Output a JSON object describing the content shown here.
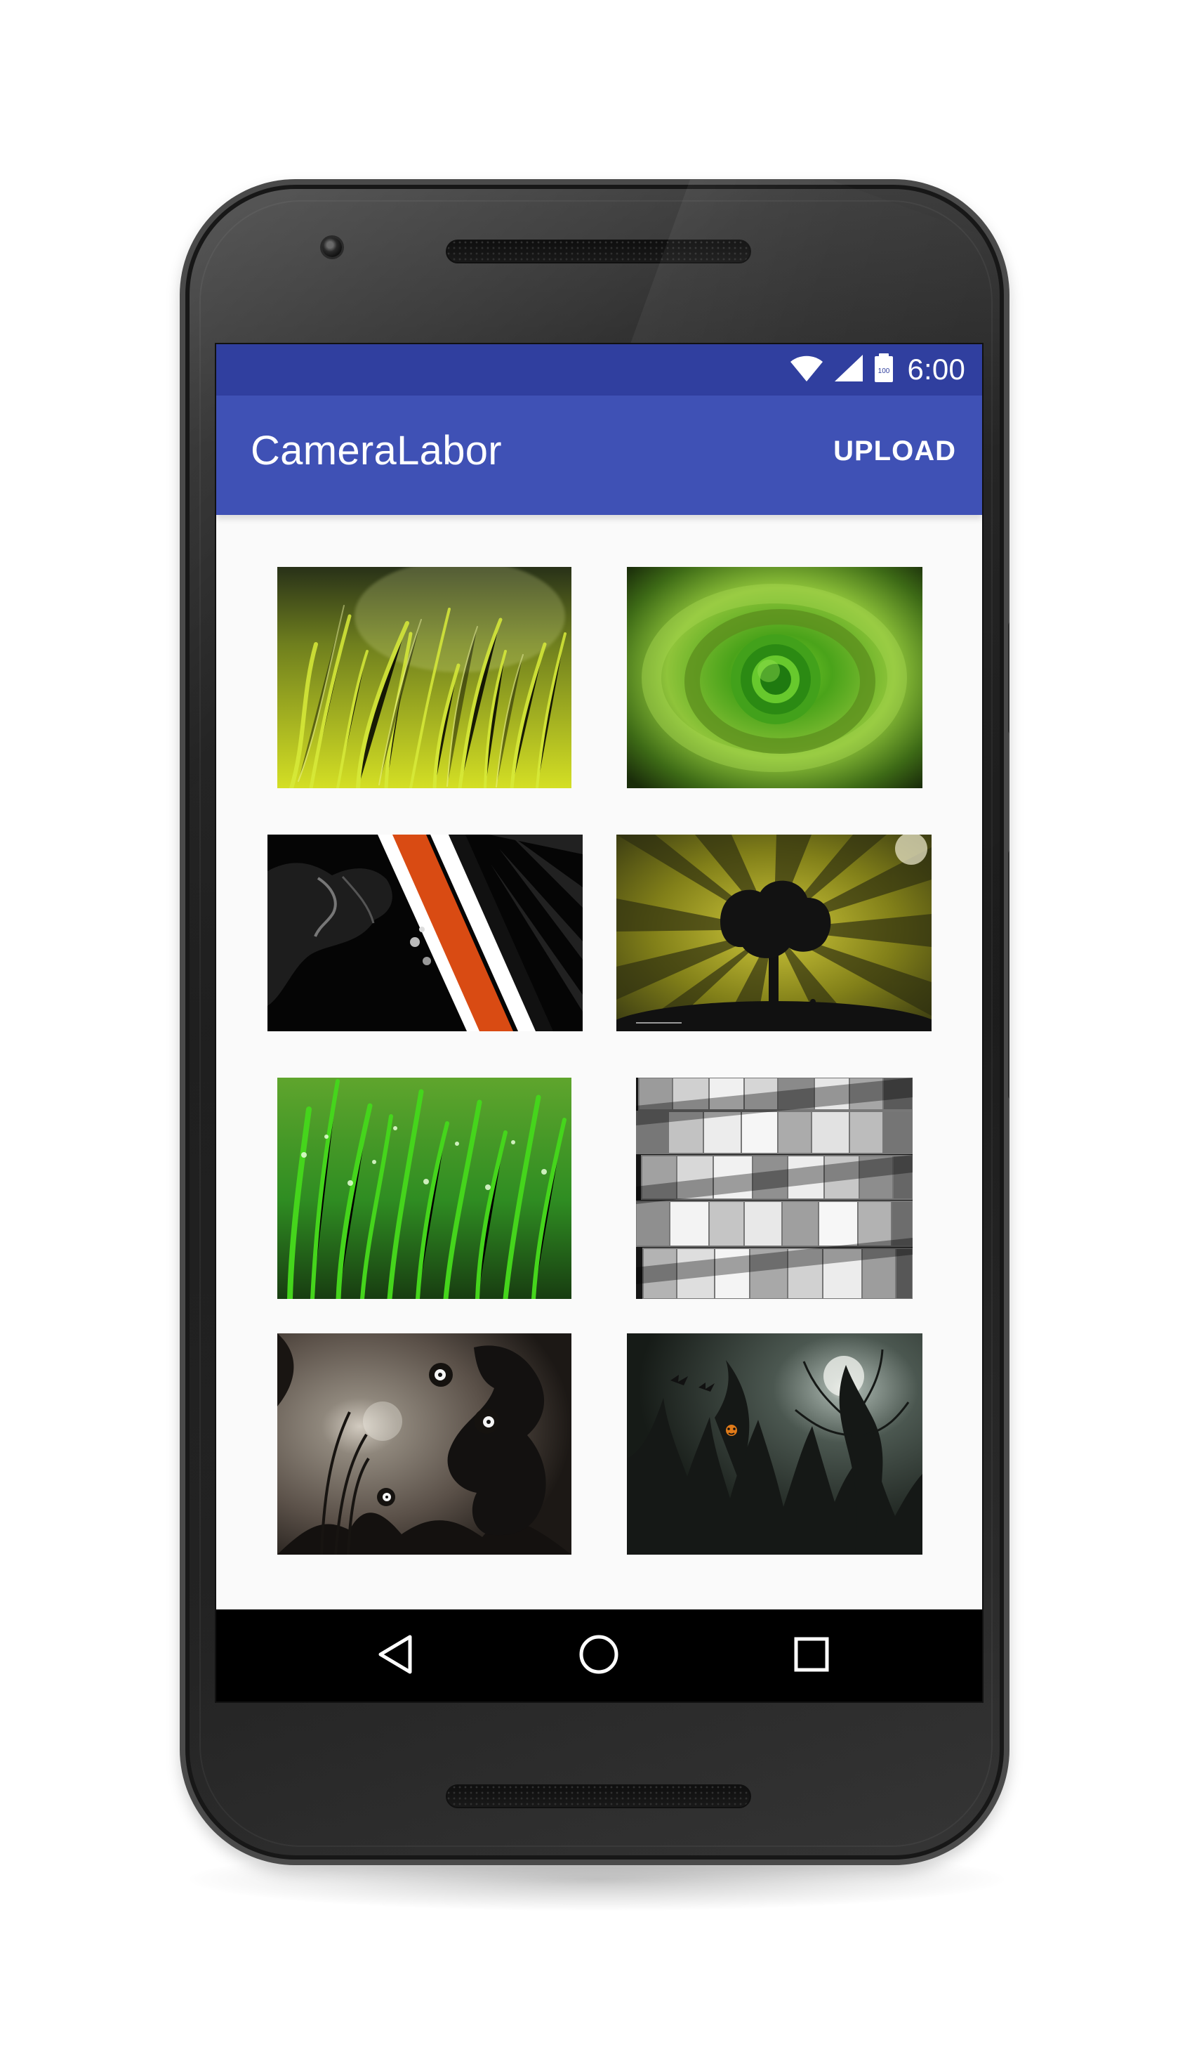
{
  "status_bar": {
    "time": "6:00",
    "battery_level": "100",
    "icons": [
      "wifi-icon",
      "signal-icon",
      "battery-icon"
    ]
  },
  "app_bar": {
    "title": "CameraLabor",
    "action_label": "UPLOAD"
  },
  "gallery": {
    "images": [
      {
        "icon": "grass-image"
      },
      {
        "icon": "green-bottle-image"
      },
      {
        "icon": "orange-stripe-image"
      },
      {
        "icon": "tree-sunburst-image"
      },
      {
        "icon": "dewy-grass-image"
      },
      {
        "icon": "cubes-image"
      },
      {
        "icon": "creature-art-image"
      },
      {
        "icon": "dark-forest-image"
      }
    ]
  },
  "navigation": {
    "icons": [
      "back-icon",
      "home-icon",
      "recents-icon"
    ]
  },
  "colors": {
    "status_bar": "#303f9f",
    "app_bar": "#3f51b5",
    "screen_background": "#fafafa",
    "navigation_bar": "#000000",
    "phone_body": "#1f1f1f"
  }
}
